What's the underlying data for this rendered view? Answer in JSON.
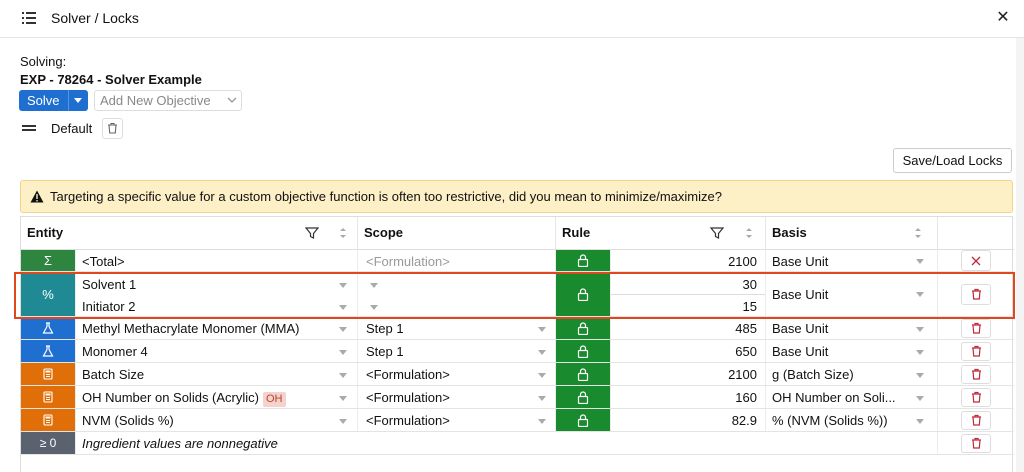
{
  "header": {
    "title": "Solver / Locks",
    "close_glyph": "✕"
  },
  "solving": {
    "label": "Solving:",
    "experiment": "EXP - 78264 - Solver Example"
  },
  "solve_button": {
    "label": "Solve"
  },
  "objective": {
    "placeholder": "Add New Objective"
  },
  "default": {
    "label": "Default"
  },
  "save_load": {
    "label": "Save/Load Locks"
  },
  "warning": {
    "text": "Targeting a specific value for a custom objective function is often too restrictive, did you mean to minimize/maximize?"
  },
  "table": {
    "columns": {
      "entity": "Entity",
      "scope": "Scope",
      "rule": "Rule",
      "basis": "Basis"
    },
    "rows": [
      {
        "type_glyph": "Σ",
        "type_color": "#2e8540",
        "name": "<Total>",
        "scope": "<Formulation>",
        "value": "2100",
        "basis": "Base Unit",
        "action": "remove"
      },
      {
        "type_glyph": "%",
        "type_color": "#1f8a94",
        "names": [
          "Solvent 1",
          "Initiator 2"
        ],
        "values": [
          "30",
          "15"
        ],
        "basis": "Base Unit",
        "action": "delete"
      },
      {
        "type_glyph": "flask",
        "type_color": "#1f6fd1",
        "name": "Methyl Methacrylate Monomer (MMA)",
        "scope": "Step 1",
        "value": "485",
        "basis": "Base Unit",
        "action": "delete"
      },
      {
        "type_glyph": "flask",
        "type_color": "#1f6fd1",
        "name": "Monomer 4",
        "scope": "Step 1",
        "value": "650",
        "basis": "Base Unit",
        "action": "delete"
      },
      {
        "type_glyph": "calc",
        "type_color": "#e06f0a",
        "name": "Batch Size",
        "scope": "<Formulation>",
        "value": "2100",
        "basis": "g (Batch Size)",
        "action": "delete"
      },
      {
        "type_glyph": "calc",
        "type_color": "#e06f0a",
        "name": "OH Number on Solids (Acrylic)",
        "badge": "OH",
        "scope": "<Formulation>",
        "value": "160",
        "basis": "OH Number on Soli...",
        "action": "delete"
      },
      {
        "type_glyph": "calc",
        "type_color": "#e06f0a",
        "name": "NVM (Solids %)",
        "scope": "<Formulation>",
        "value": "82.9",
        "basis": "% (NVM (Solids %))",
        "action": "delete"
      },
      {
        "type_glyph": "≥ 0",
        "type_color": "#5a6270",
        "name": "Ingredient values are nonnegative",
        "action": "delete"
      }
    ]
  },
  "colors": {
    "primary": "#1f6fd1",
    "rule_green": "#1a8a2e",
    "highlight": "#e0471f",
    "danger": "#c0283b"
  }
}
